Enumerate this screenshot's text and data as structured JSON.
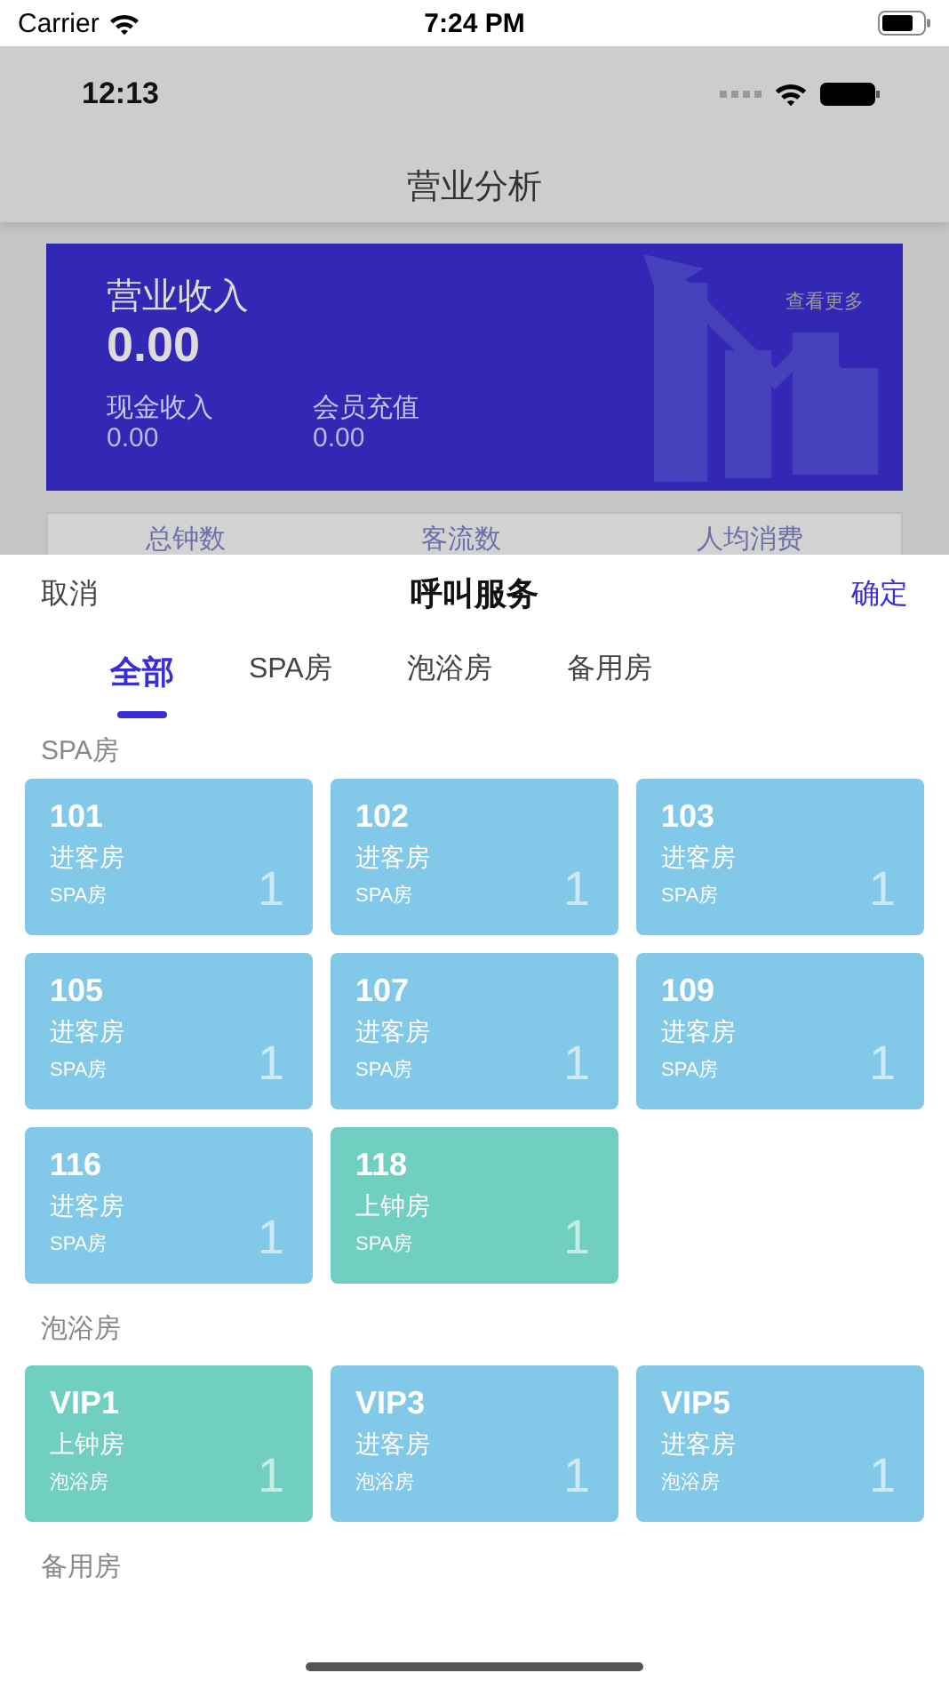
{
  "status_bar": {
    "carrier": "Carrier",
    "time": "7:24 PM"
  },
  "background_app": {
    "status_time": "12:13",
    "title": "营业分析",
    "revenue_card": {
      "label": "营业收入",
      "value": "0.00",
      "more": "查看更多",
      "cash_label": "现金收入",
      "cash_value": "0.00",
      "member_label": "会员充值",
      "member_value": "0.00"
    },
    "stats": [
      "总钟数",
      "客流数",
      "人均消费"
    ]
  },
  "sheet": {
    "cancel": "取消",
    "title": "呼叫服务",
    "confirm": "确定",
    "tabs": [
      {
        "label": "全部",
        "selected": true
      },
      {
        "label": "SPA房",
        "selected": false
      },
      {
        "label": "泡浴房",
        "selected": false
      },
      {
        "label": "备用房",
        "selected": false
      }
    ],
    "sections": [
      {
        "title": "SPA房",
        "rooms": [
          {
            "number": "101",
            "status": "进客房",
            "type": "SPA房",
            "count": "1",
            "color": "#82c8e8"
          },
          {
            "number": "102",
            "status": "进客房",
            "type": "SPA房",
            "count": "1",
            "color": "#82c8e8"
          },
          {
            "number": "103",
            "status": "进客房",
            "type": "SPA房",
            "count": "1",
            "color": "#82c8e8"
          },
          {
            "number": "105",
            "status": "进客房",
            "type": "SPA房",
            "count": "1",
            "color": "#82c8e8"
          },
          {
            "number": "107",
            "status": "进客房",
            "type": "SPA房",
            "count": "1",
            "color": "#82c8e8"
          },
          {
            "number": "109",
            "status": "进客房",
            "type": "SPA房",
            "count": "1",
            "color": "#82c8e8"
          },
          {
            "number": "116",
            "status": "进客房",
            "type": "SPA房",
            "count": "1",
            "color": "#82c8e8"
          },
          {
            "number": "118",
            "status": "上钟房",
            "type": "SPA房",
            "count": "1",
            "color": "#70cfc1"
          }
        ]
      },
      {
        "title": "泡浴房",
        "rooms": [
          {
            "number": "VIP1",
            "status": "上钟房",
            "type": "泡浴房",
            "count": "1",
            "color": "#70cfc1"
          },
          {
            "number": "VIP3",
            "status": "进客房",
            "type": "泡浴房",
            "count": "1",
            "color": "#82c8e8"
          },
          {
            "number": "VIP5",
            "status": "进客房",
            "type": "泡浴房",
            "count": "1",
            "color": "#82c8e8"
          }
        ]
      },
      {
        "title": "备用房"
      }
    ]
  }
}
